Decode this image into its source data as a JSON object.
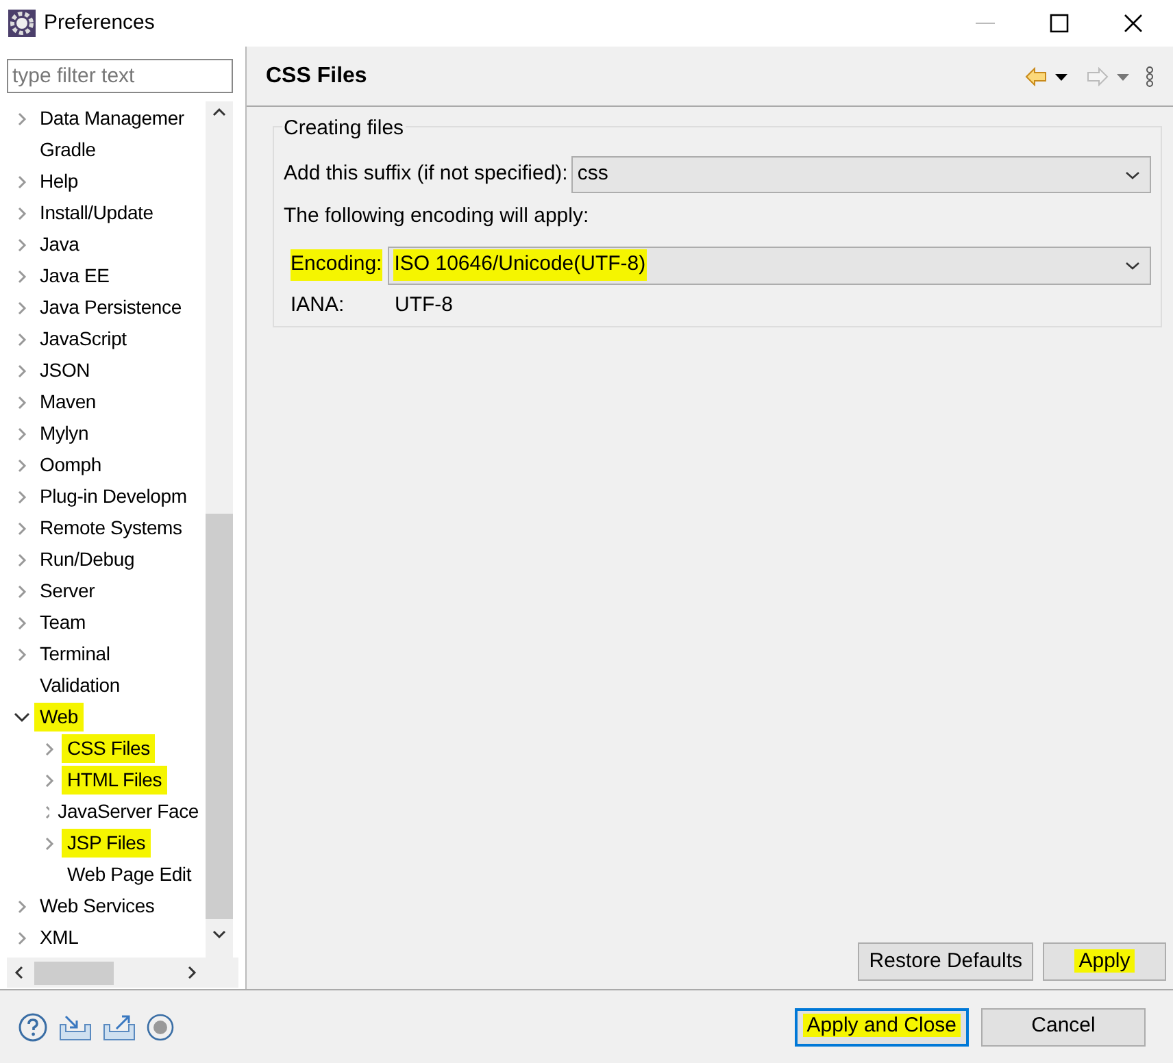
{
  "window": {
    "title": "Preferences"
  },
  "filter": {
    "placeholder": "type filter text"
  },
  "tree": [
    {
      "label": "Data Managemer",
      "kind": "node",
      "expanded": false,
      "highlighted": false
    },
    {
      "label": "Gradle",
      "kind": "leaf",
      "highlighted": false
    },
    {
      "label": "Help",
      "kind": "node",
      "expanded": false,
      "highlighted": false
    },
    {
      "label": "Install/Update",
      "kind": "node",
      "expanded": false,
      "highlighted": false
    },
    {
      "label": "Java",
      "kind": "node",
      "expanded": false,
      "highlighted": false
    },
    {
      "label": "Java EE",
      "kind": "node",
      "expanded": false,
      "highlighted": false
    },
    {
      "label": "Java Persistence",
      "kind": "node",
      "expanded": false,
      "highlighted": false
    },
    {
      "label": "JavaScript",
      "kind": "node",
      "expanded": false,
      "highlighted": false
    },
    {
      "label": "JSON",
      "kind": "node",
      "expanded": false,
      "highlighted": false
    },
    {
      "label": "Maven",
      "kind": "node",
      "expanded": false,
      "highlighted": false
    },
    {
      "label": "Mylyn",
      "kind": "node",
      "expanded": false,
      "highlighted": false
    },
    {
      "label": "Oomph",
      "kind": "node",
      "expanded": false,
      "highlighted": false
    },
    {
      "label": "Plug-in Developm",
      "kind": "node",
      "expanded": false,
      "highlighted": false
    },
    {
      "label": "Remote Systems",
      "kind": "node",
      "expanded": false,
      "highlighted": false
    },
    {
      "label": "Run/Debug",
      "kind": "node",
      "expanded": false,
      "highlighted": false
    },
    {
      "label": "Server",
      "kind": "node",
      "expanded": false,
      "highlighted": false
    },
    {
      "label": "Team",
      "kind": "node",
      "expanded": false,
      "highlighted": false
    },
    {
      "label": "Terminal",
      "kind": "node",
      "expanded": false,
      "highlighted": false
    },
    {
      "label": "Validation",
      "kind": "leaf",
      "highlighted": false
    },
    {
      "label": "Web",
      "kind": "node",
      "expanded": true,
      "highlighted": true,
      "children": [
        {
          "label": "CSS Files",
          "kind": "node",
          "expanded": false,
          "highlighted": true
        },
        {
          "label": "HTML Files",
          "kind": "node",
          "expanded": false,
          "highlighted": true
        },
        {
          "label": "JavaServer Face",
          "kind": "node",
          "expanded": false,
          "highlighted": false
        },
        {
          "label": "JSP Files",
          "kind": "node",
          "expanded": false,
          "highlighted": true
        },
        {
          "label": "Web Page Edit",
          "kind": "leaf",
          "highlighted": false
        }
      ]
    },
    {
      "label": "Web Services",
      "kind": "node",
      "expanded": false,
      "highlighted": false
    },
    {
      "label": "XML",
      "kind": "node",
      "expanded": false,
      "highlighted": false
    }
  ],
  "page": {
    "title": "CSS Files",
    "group": {
      "title": "Creating files",
      "suffix_label": "Add this suffix (if not specified):",
      "suffix_value": "css",
      "encoding_note": "The following encoding will apply:",
      "encoding_label": "Encoding:",
      "encoding_value": "ISO 10646/Unicode(UTF-8)",
      "encoding_highlighted": true,
      "iana_label": "IANA:",
      "iana_value": "UTF-8"
    },
    "buttons": [
      {
        "label": "Restore Defaults",
        "highlighted": false
      },
      {
        "label": "Apply",
        "highlighted": true
      }
    ]
  },
  "footer_buttons": [
    {
      "label": "Apply and Close",
      "highlighted": true,
      "default": true
    },
    {
      "label": "Cancel",
      "highlighted": false,
      "default": false
    }
  ]
}
